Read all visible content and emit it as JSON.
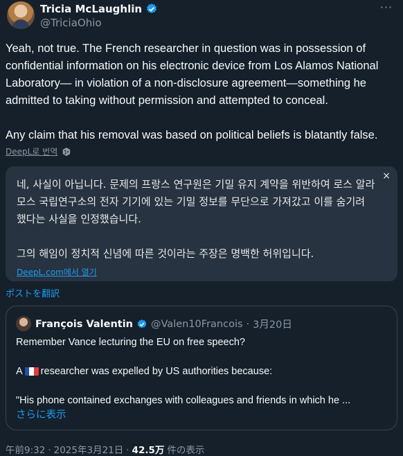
{
  "author": {
    "name": "Tricia McLaughlin",
    "handle": "@TriciaOhio"
  },
  "more_glyph": "···",
  "tweet": {
    "text": "Yeah, not true. The French researcher in question was in possession of confidential information on his electronic device from Los Alamos National Laboratory— in violation of a non-disclosure agreement—something he admitted to taking without permission and attempted to conceal.\n\nAny claim that his removal was based on political beliefs is blatantly false."
  },
  "deepl": {
    "label": "DeepL로 번역"
  },
  "translation": {
    "text": "네, 사실이 아닙니다. 문제의 프랑스 연구원은 기밀 유지 계약을 위반하여 로스 알라모스 국립연구소의 전자 기기에 있는 기밀 정보를 무단으로 가져갔고 이를 숨기려 했다는 사실을 인정했습니다.\n\n그의 해임이 정치적 신념에 따른 것이라는 주장은 명백한 허위입니다.",
    "close": "×",
    "open_link": "DeepL.com에서 열기"
  },
  "translate_post": "ポストを翻訳",
  "quote": {
    "name": "François Valentin",
    "handle": "@Valen10Francois",
    "separator": "·",
    "date": "3月20日",
    "line1": "Remember Vance lecturing the EU on free speech?",
    "line2_prefix": "A",
    "line2_suffix": "researcher was expelled by US authorities because:",
    "line3": "\"His phone contained exchanges with colleagues and friends in which he ...",
    "show_more": "さらに表示"
  },
  "footer": {
    "time": "午前9:32",
    "separator": "·",
    "date": "2025年3月21日",
    "views_count": "42.5万",
    "views_label": "件の表示"
  },
  "colors": {
    "background": "#15202b",
    "accent": "#1d9bf0",
    "muted": "#8b98a5",
    "panel": "#273340"
  }
}
